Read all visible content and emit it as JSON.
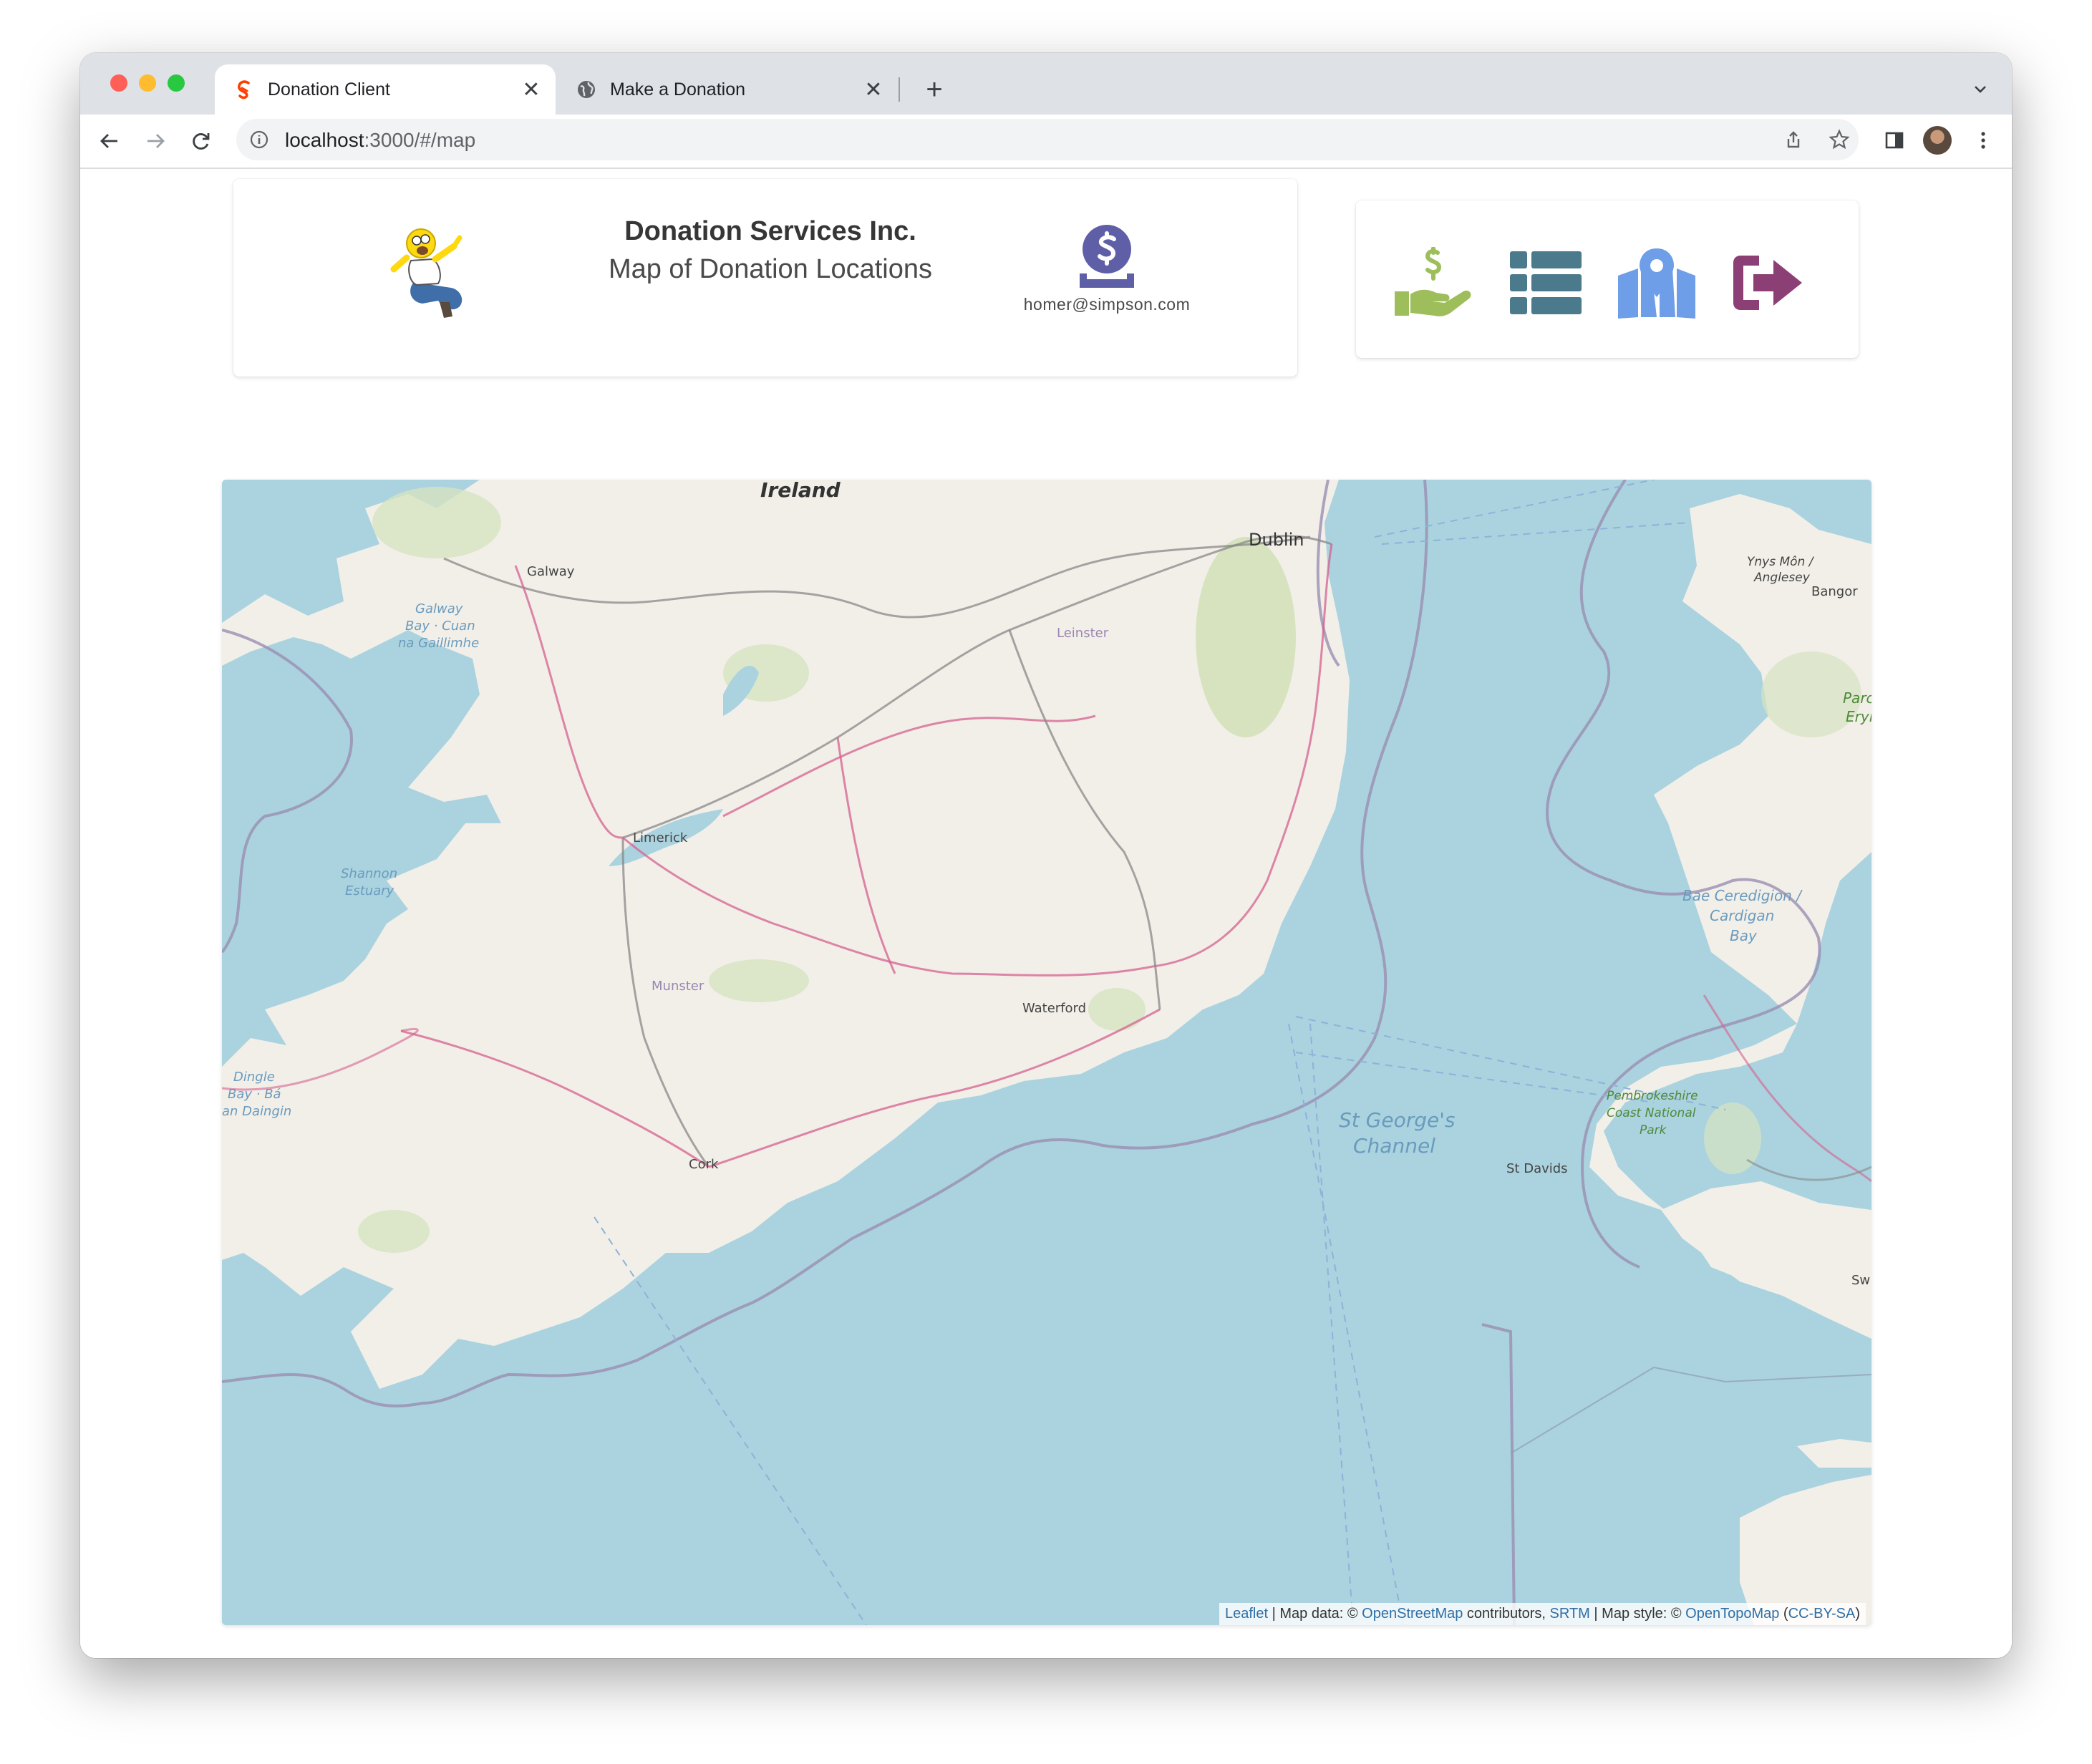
{
  "browser": {
    "tabs": [
      {
        "title": "Donation Client",
        "active": true,
        "icon": "svelte-icon"
      },
      {
        "title": "Make a Donation",
        "active": false,
        "icon": "globe-icon"
      }
    ],
    "url_host": "localhost",
    "url_rest": ":3000/#/map"
  },
  "header": {
    "title": "Donation Services Inc.",
    "subtitle": "Map of Donation Locations",
    "user_email": "homer@simpson.com"
  },
  "menu": {
    "items": [
      {
        "name": "donate",
        "icon": "hand-holding-dollar-icon",
        "color": "#9dbe5b"
      },
      {
        "name": "report",
        "icon": "table-list-icon",
        "color": "#4a7a8c"
      },
      {
        "name": "map",
        "icon": "map-location-icon",
        "color": "#6e9ee8"
      },
      {
        "name": "logout",
        "icon": "sign-out-icon",
        "color": "#8c3f75"
      }
    ]
  },
  "map": {
    "labels": {
      "ireland": "Ireland",
      "dublin": "Dublin",
      "galway": "Galway",
      "galway_bay_1": "Galway",
      "galway_bay_2": "Bay · Cuan",
      "galway_bay_3": "na Gaillimhe",
      "limerick": "Limerick",
      "leinster": "Leinster",
      "munster": "Munster",
      "waterford": "Waterford",
      "cork": "Cork",
      "shannon_1": "Shannon",
      "shannon_2": "Estuary",
      "dingle_1": "Dingle",
      "dingle_2": "Bay · Bá",
      "dingle_3": "an Daingin",
      "st_george_1": "St George's",
      "st_george_2": "Channel",
      "anglesey_1": "Ynys Môn /",
      "anglesey_2": "Anglesey",
      "bangor": "Bangor",
      "cardigan_1": "Bae Ceredigion /",
      "cardigan_2": "Cardigan",
      "cardigan_3": "Bay",
      "pembs_1": "Pembrokeshire",
      "pembs_2": "Coast National",
      "pembs_3": "Park",
      "st_davids": "St Davids",
      "parc_1": "Parc",
      "parc_2": "Eryi",
      "sw": "Sw"
    },
    "attribution": {
      "leaflet": "Leaflet",
      "sep1": " | Map data: © ",
      "osm": "OpenStreetMap",
      "contrib": " contributors, ",
      "srtm": "SRTM",
      "sep2": " | Map style: © ",
      "otm": "OpenTopoMap",
      "open_paren": " (",
      "license": "CC-BY-SA",
      "close_paren": ")"
    }
  }
}
